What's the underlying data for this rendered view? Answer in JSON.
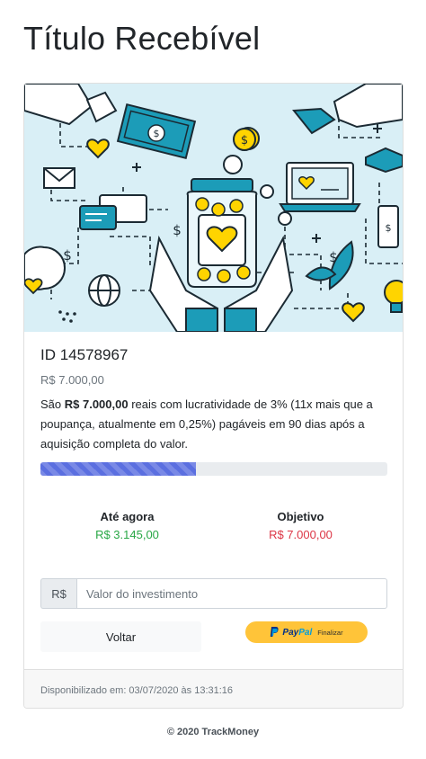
{
  "page": {
    "title": "Título Recebível"
  },
  "card": {
    "id_label": "ID 14578967",
    "value": "R$ 7.000,00",
    "description": {
      "prefix": "São ",
      "amount": "R$ 7.000,00",
      "suffix": " reais com lucratividade de 3% (11x mais que a poupança, atualmente em 0,25%) pagáveis em 90 dias após a aquisição completa do valor."
    },
    "progress": {
      "current": 3145,
      "goal": 7000,
      "fraction": 0.449
    },
    "stats": {
      "so_far_label": "Até agora",
      "so_far_value": "R$ 3.145,00",
      "goal_label": "Objetivo",
      "goal_value": "R$ 7.000,00"
    },
    "investment": {
      "currency_prefix": "R$",
      "placeholder": "Valor do investimento",
      "value": ""
    },
    "buttons": {
      "back_label": "Voltar",
      "paypal_pay": "Pay",
      "paypal_pal": "Pal",
      "paypal_cta": "Finalizar"
    },
    "footer": "Disponibilizado em: 03/07/2020 às 13:31:16"
  },
  "colors": {
    "progress": "#5b6fe0",
    "so_far": "#28a745",
    "goal": "#dc3545",
    "paypal": "#ffc439",
    "illustration_teal": "#1c9cb8",
    "illustration_bg": "#d9eff6",
    "illustration_yellow": "#ffd400"
  },
  "footer": {
    "copyright": "© 2020 TrackMoney"
  }
}
